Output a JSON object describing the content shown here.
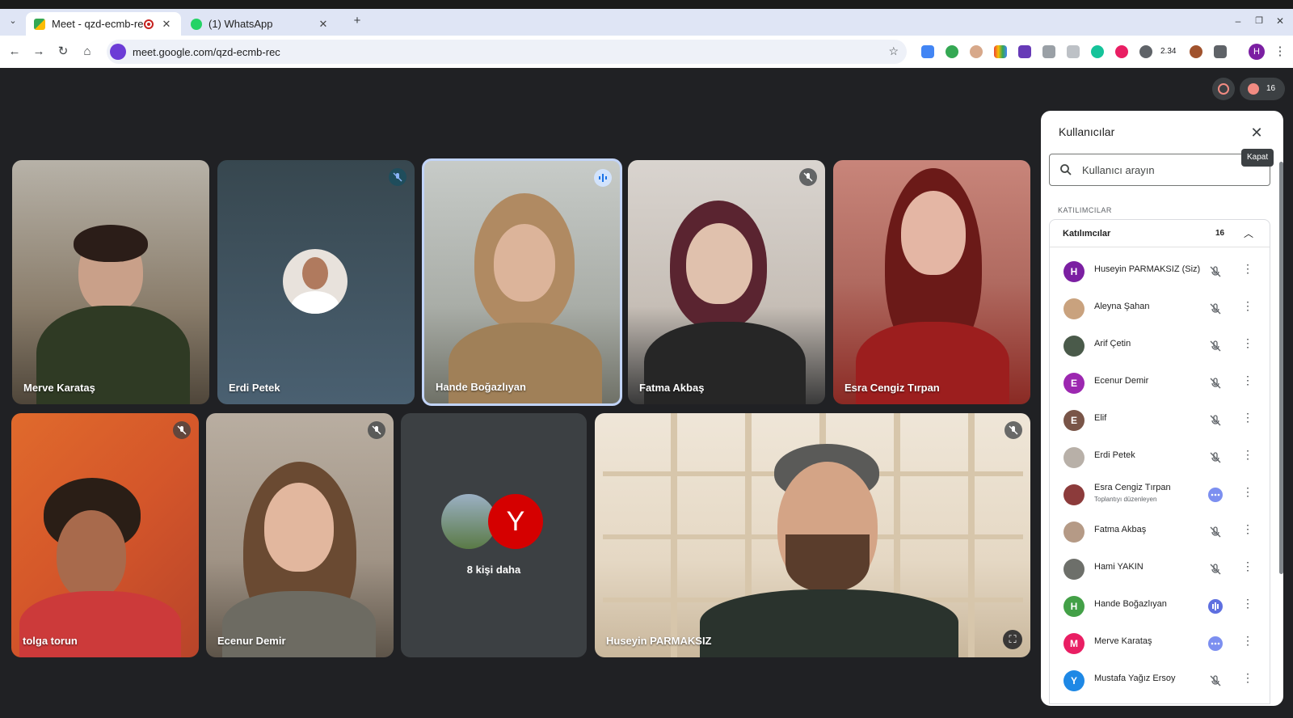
{
  "browser": {
    "tabs": [
      {
        "title": "Meet - qzd-ecmb-rec",
        "close": "✕"
      },
      {
        "title": "(1) WhatsApp",
        "close": "✕"
      }
    ],
    "new_tab": "+",
    "url": "meet.google.com/qzd-ecmb-rec",
    "nav": {
      "back": "←",
      "forward": "→",
      "reload": "↻",
      "home": "⌂",
      "star": "☆"
    },
    "window_controls": {
      "minimize": "–",
      "restore": "❐",
      "close": "✕"
    },
    "extension_badge": "2.34",
    "profile_initial": "H",
    "menu": "⋮"
  },
  "meet": {
    "participant_count_badge": "16",
    "tiles": [
      {
        "name": "Merve Karataş",
        "muted": false
      },
      {
        "name": "Erdi Petek",
        "muted": true
      },
      {
        "name": "Hande Boğazlıyan",
        "speaking": true
      },
      {
        "name": "Fatma Akbaş",
        "muted": true
      },
      {
        "name": "Esra Cengiz Tırpan",
        "muted": false
      },
      {
        "name": "tolga torun",
        "muted": true
      },
      {
        "name": "Ecenur Demir",
        "muted": true
      },
      {
        "name": "8 kişi daha",
        "avatar_letter": "Y"
      },
      {
        "name": "Huseyin PARMAKSIZ",
        "muted": true
      }
    ]
  },
  "panel": {
    "title": "Kullanıcılar",
    "close": "✕",
    "close_tooltip": "Kapat",
    "search_placeholder": "Kullanıcı arayın",
    "section_label": "KATILIMCILAR",
    "group_label": "Katılımcılar",
    "group_count": "16",
    "group_toggle": "︿",
    "participants": [
      {
        "initial": "H",
        "name": "Huseyin PARMAKSIZ (Siz)",
        "color": "#7b1fa2",
        "mic": "muted"
      },
      {
        "initial": "",
        "name": "Aleyna Şahan",
        "color": "#c9a27e",
        "mic": "muted"
      },
      {
        "initial": "",
        "name": "Arif Çetin",
        "color": "#4a5a4a",
        "mic": "muted"
      },
      {
        "initial": "E",
        "name": "Ecenur Demir",
        "color": "#9c27b0",
        "mic": "muted"
      },
      {
        "initial": "E",
        "name": "Elif",
        "color": "#795548",
        "mic": "muted"
      },
      {
        "initial": "",
        "name": "Erdi Petek",
        "color": "#b8b0a8",
        "mic": "muted"
      },
      {
        "initial": "",
        "name": "Esra Cengiz Tırpan",
        "sub": "Toplantıyı düzenleyen",
        "color": "#8c3b3b",
        "mic": "more"
      },
      {
        "initial": "",
        "name": "Fatma Akbaş",
        "color": "#b59a86",
        "mic": "muted"
      },
      {
        "initial": "",
        "name": "Hami YAKIN",
        "color": "#6d6f6a",
        "mic": "muted"
      },
      {
        "initial": "H",
        "name": "Hande Boğazlıyan",
        "color": "#43a047",
        "mic": "speaking"
      },
      {
        "initial": "M",
        "name": "Merve Karataş",
        "color": "#e91e63",
        "mic": "more"
      },
      {
        "initial": "Y",
        "name": "Mustafa Yağız Ersoy",
        "color": "#1e88e5",
        "mic": "muted"
      }
    ],
    "row_menu": "⋮"
  }
}
